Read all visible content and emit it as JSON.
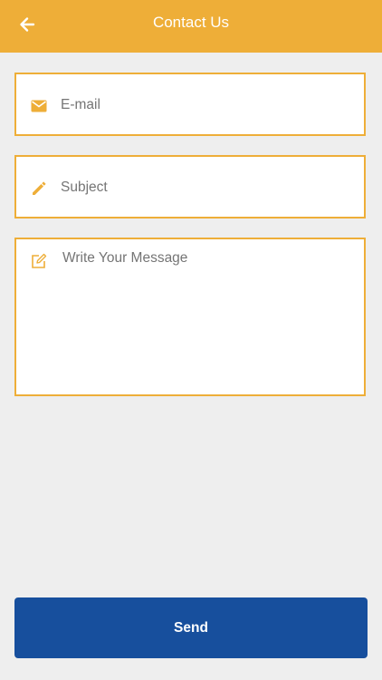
{
  "header": {
    "title": "Contact Us",
    "back_icon": "arrow-left-icon",
    "background": "#eeae38"
  },
  "form": {
    "email": {
      "placeholder": "E-mail",
      "value": "",
      "icon": "envelope-icon"
    },
    "subject": {
      "placeholder": "Subject",
      "value": "",
      "icon": "pencil-icon"
    },
    "message": {
      "placeholder": "Write Your Message",
      "value": "",
      "icon": "edit-note-icon"
    },
    "accent": "#eeae38"
  },
  "send_button": {
    "label": "Send",
    "background": "#174f9d"
  }
}
